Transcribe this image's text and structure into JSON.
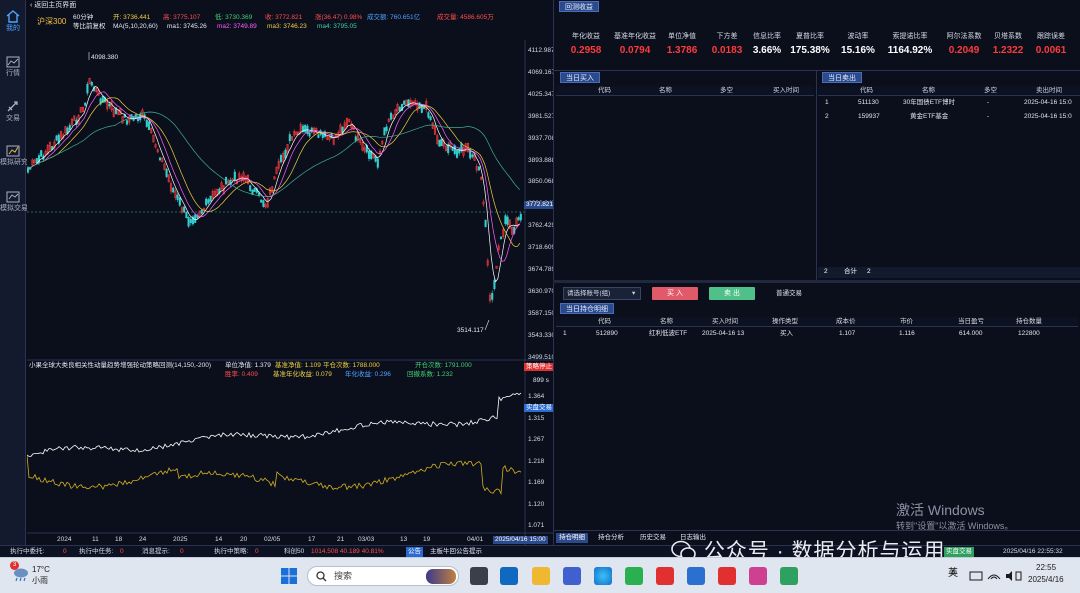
{
  "sidebar": {
    "items": [
      {
        "label": "我的",
        "icon": "home-icon"
      },
      {
        "label": "行情",
        "icon": "chart-icon"
      },
      {
        "label": "交易",
        "icon": "trade-icon"
      },
      {
        "label": "模拟研究",
        "icon": "research-icon"
      },
      {
        "label": "模拟交易",
        "icon": "sim-trade-icon"
      }
    ]
  },
  "chart": {
    "back_label": "返回主页界面",
    "symbol": "沪深300",
    "period": "60分钟",
    "adjust": "等比前复权",
    "open": "开: 3736.441",
    "high": "高: 3775.107",
    "low": "低: 3730.369",
    "close": "收: 3772.821",
    "change": "涨(36.47) 0.98%",
    "amount": "成交额: 760.651亿",
    "volume": "成交量: 4586.605万",
    "ma_params": "MA(5,10,20,60)",
    "ma1": "ma1: 3745.26",
    "ma2": "ma2: 3749.89",
    "ma3": "ma3: 3746.23",
    "ma4": "ma4: 3795.05",
    "high_marker": "4098.380",
    "low_marker": "3514.117",
    "price_axis": [
      "4112.987",
      "4069.167",
      "4025.347",
      "3981.527",
      "3937.708",
      "3893.888",
      "3850.068",
      "3806.249",
      "3762.429",
      "3718.609",
      "3674.789",
      "3630.970",
      "3587.150",
      "3543.330",
      "3499.510"
    ],
    "current_price_tag": "3772.821",
    "strategy_line": "小果全球大类良相关性动量趋势增强轮动策略回测(14,150,-200)",
    "unit_nav": "单位净值: 1.379",
    "bench_nav": "基准净值: 1.109",
    "open_count": "平仓次数: 1788.000",
    "open_count2": "开仓次数: 1791.000",
    "win_rate": "胜率: 0.409",
    "bench_annual": "基准年化收益: 0.079",
    "annual": "年化收益: 0.296",
    "beta": "回撤系数: 1.232",
    "tag_stop": "策略停止",
    "tag_live": "实盘交易",
    "tag_value": "899 s",
    "nav_axis": [
      "1.364",
      "1.315",
      "1.267",
      "1.218",
      "1.169",
      "1.120",
      "1.071"
    ],
    "x_axis": [
      "2024",
      "11",
      "18",
      "24",
      "2025",
      "14",
      "20",
      "02/05",
      "17",
      "21",
      "03/03",
      "13",
      "19",
      "04/01"
    ],
    "x_current": "2025/04/16 15:00"
  },
  "metrics": {
    "tab": "回测收益",
    "labels": [
      "年化收益",
      "基准年化收益",
      "单位净值",
      "下方差",
      "信息比率",
      "夏普比率",
      "波动率",
      "索提诺比率",
      "阿尔法系数",
      "贝塔系数",
      "跟踪误差"
    ],
    "values": [
      "0.2958",
      "0.0794",
      "1.3786",
      "0.0183",
      "3.66%",
      "175.38%",
      "15.16%",
      "1164.92%",
      "0.2049",
      "1.2322",
      "0.0061"
    ],
    "value_colors": [
      "red",
      "red",
      "red",
      "red",
      "white",
      "white",
      "white",
      "white",
      "red",
      "red",
      "red"
    ]
  },
  "buy_table": {
    "tab": "当日买入",
    "headers": [
      "代码",
      "名称",
      "多空",
      "买入时间"
    ]
  },
  "sell_table": {
    "tab": "当日卖出",
    "headers": [
      "代码",
      "名称",
      "多空",
      "卖出时间"
    ],
    "rows": [
      {
        "idx": "1",
        "code": "511130",
        "name": "30年国债ETF博时",
        "dir": "-",
        "time": "2025-04-16 15:0"
      },
      {
        "idx": "2",
        "code": "159937",
        "name": "黄金ETF基金",
        "dir": "-",
        "time": "2025-04-16 15:0"
      }
    ],
    "footer_count": "2",
    "footer_label": "合计",
    "footer_total": "2"
  },
  "trade_bar": {
    "account_placeholder": "请选择账号(组)",
    "buy": "买 入",
    "sell": "卖 出",
    "mode": "普通交易"
  },
  "holdings": {
    "tab": "当日持仓明细",
    "headers": [
      "代码",
      "名称",
      "买入时间",
      "操作类型",
      "成本价",
      "市价",
      "当日盈亏",
      "持仓数量"
    ],
    "rows": [
      {
        "idx": "1",
        "code": "512890",
        "name": "红利低波ETF",
        "time": "2025-04-16 13",
        "op": "买入",
        "cost": "1.107",
        "price": "1.116",
        "pnl": "614.000",
        "qty": "122800"
      }
    ]
  },
  "bottom_tabs": [
    "持仓明细",
    "持仓分析",
    "历史交易",
    "日志输出"
  ],
  "status": {
    "exec_delegate": "执行中委托:",
    "exec_delegate_v": "0",
    "exec_task": "执行中任务:",
    "exec_task_v": "0",
    "msg": "消息提示:",
    "msg_v": "0",
    "exec_strategy": "执行中策略:",
    "exec_strategy_v": "0",
    "account": "科创50",
    "account_v": "1014.508  40.189  40.81%",
    "notice_tag": "公告",
    "notice": "主板牛回公告提示",
    "right_tag": "实盘交易",
    "right_time": "2025/04/16 22:55:32"
  },
  "taskbar": {
    "weather_temp": "17°C",
    "weather_desc": "小雨",
    "search_placeholder": "搜索",
    "ime": "英",
    "time": "22:55",
    "date": "2025/4/16"
  },
  "watermark": {
    "activate": "激活 Windows",
    "activate_sub": "转到\"设置\"以激活 Windows。",
    "wechat": "公众号 · 数据分析与运用"
  }
}
